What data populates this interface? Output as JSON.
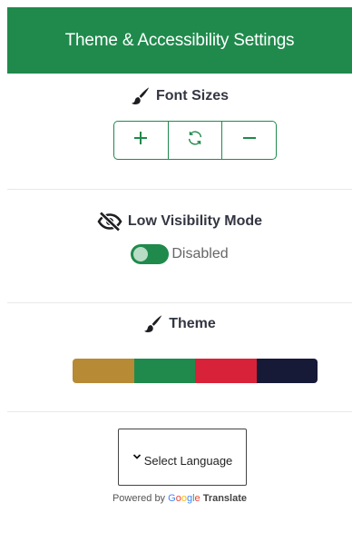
{
  "header": {
    "title": "Theme & Accessibility Settings"
  },
  "font_sizes": {
    "title": "Font Sizes",
    "icon": "paintbrush-icon",
    "buttons": [
      {
        "name": "increase",
        "icon": "plus-icon"
      },
      {
        "name": "reset",
        "icon": "refresh-icon"
      },
      {
        "name": "decrease",
        "icon": "minus-icon"
      }
    ]
  },
  "low_visibility": {
    "title": "Low Visibility Mode",
    "icon": "eye-slash-icon",
    "status": "Disabled"
  },
  "theme": {
    "title": "Theme",
    "icon": "paintbrush-icon",
    "swatches": [
      "#b78a35",
      "#1f8a4c",
      "#d82239",
      "#161a37"
    ]
  },
  "language": {
    "select_label": "Select Language",
    "powered_by": "Powered by",
    "google": "Google",
    "translate": "Translate"
  },
  "colors": {
    "brand": "#1f8a4c"
  }
}
